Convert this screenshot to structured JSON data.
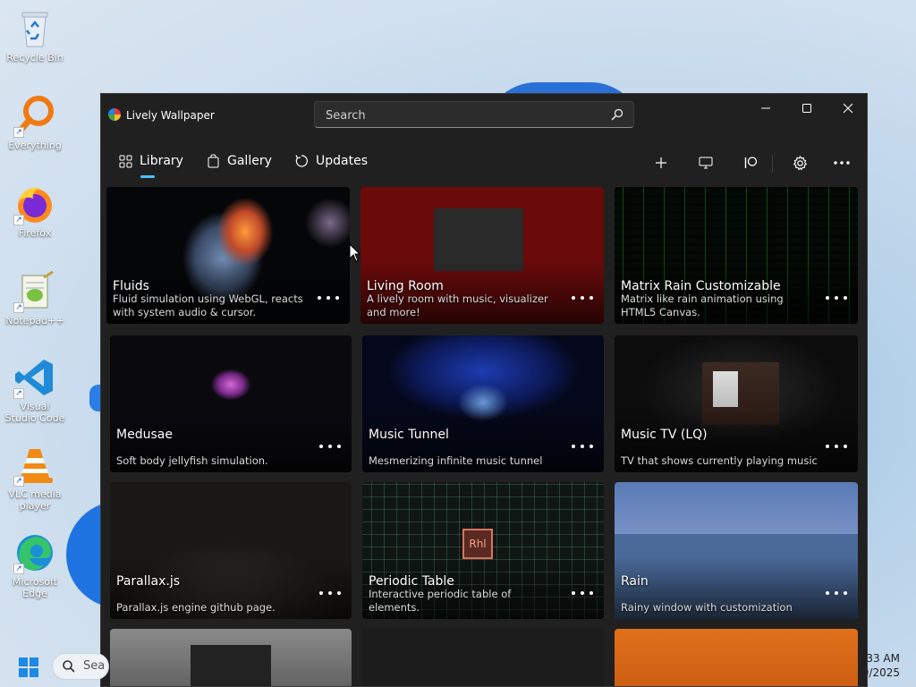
{
  "desktop": {
    "icons": [
      {
        "label": "Recycle Bin",
        "icon": "recycle-bin-icon"
      },
      {
        "label": "Everything",
        "icon": "everything-search-icon"
      },
      {
        "label": "Firefox",
        "icon": "firefox-icon"
      },
      {
        "label": "Notepad++",
        "icon": "notepad-plus-plus-icon"
      },
      {
        "label": "Visual Studio Code",
        "icon": "vscode-icon"
      },
      {
        "label": "VLC media player",
        "icon": "vlc-icon"
      },
      {
        "label": "Microsoft Edge",
        "icon": "edge-icon"
      }
    ]
  },
  "window": {
    "title": "Lively Wallpaper",
    "search_placeholder": "Search",
    "nav": [
      {
        "label": "Library",
        "icon": "library-grid-icon",
        "selected": true
      },
      {
        "label": "Gallery",
        "icon": "gallery-bag-icon"
      },
      {
        "label": "Updates",
        "icon": "updates-refresh-icon"
      }
    ],
    "toolbar": [
      {
        "icon": "add-icon"
      },
      {
        "icon": "monitor-icon"
      },
      {
        "icon": "patreon-icon"
      },
      {
        "icon": "settings-gear-icon"
      },
      {
        "icon": "more-options-icon"
      }
    ],
    "accent": "#4cc2ff"
  },
  "wallpapers": [
    {
      "title": "Fluids",
      "desc": "Fluid simulation using WebGL, reacts with system audio & cursor."
    },
    {
      "title": "Living Room",
      "desc": "A lively room with music, visualizer and more!"
    },
    {
      "title": "Matrix Rain Customizable",
      "desc": "Matrix like rain animation using HTML5 Canvas."
    },
    {
      "title": "Medusae",
      "desc": "Soft body jellyfish simulation."
    },
    {
      "title": "Music Tunnel",
      "desc": "Mesmerizing infinite music tunnel"
    },
    {
      "title": "Music TV (LQ)",
      "desc": "TV that shows currently playing music"
    },
    {
      "title": "Parallax.js",
      "desc": "Parallax.js engine github page."
    },
    {
      "title": "Periodic Table",
      "desc": "Interactive periodic table of elements."
    },
    {
      "title": "Rain",
      "desc": "Rainy window with customization"
    },
    {
      "title": "",
      "desc": ""
    },
    {
      "title": "",
      "desc": ""
    },
    {
      "title": "",
      "desc": ""
    }
  ],
  "periodic_table_symbol": "Rhl",
  "taskbar": {
    "search_text": "Sea",
    "time": "33 AM",
    "date": "9/2025"
  }
}
